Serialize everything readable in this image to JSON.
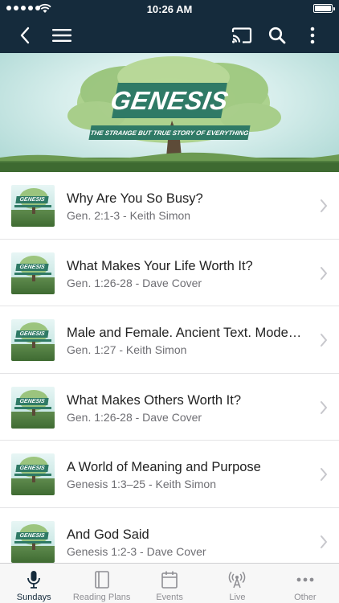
{
  "status_bar": {
    "time": "10:26 AM"
  },
  "nav": {
    "back_icon": "chevron-left-icon",
    "menu_icon": "hamburger-icon",
    "cast_icon": "cast-icon",
    "search_icon": "search-icon",
    "more_icon": "vertical-dots-icon"
  },
  "hero": {
    "title": "GENESIS",
    "subtitle": "THE STRANGE BUT TRUE STORY OF EVERYTHING"
  },
  "sermons": [
    {
      "title": "Why Are You So Busy?",
      "subtitle": "Gen. 2:1-3 - Keith Simon"
    },
    {
      "title": "What Makes Your Life Worth It?",
      "subtitle": "Gen. 1:26-28 - Dave Cover"
    },
    {
      "title": "Male and Female. Ancient Text. Mode…",
      "subtitle": "Gen. 1:27 - Keith Simon"
    },
    {
      "title": "What Makes Others Worth It?",
      "subtitle": "Gen. 1:26-28 - Dave Cover"
    },
    {
      "title": "A World of Meaning and Purpose",
      "subtitle": "Genesis 1:3–25 - Keith Simon"
    },
    {
      "title": "And God Said",
      "subtitle": "Genesis 1:2-3 - Dave Cover"
    }
  ],
  "tabs": [
    {
      "label": "Sundays",
      "icon": "microphone-icon",
      "active": true
    },
    {
      "label": "Reading Plans",
      "icon": "book-icon",
      "active": false
    },
    {
      "label": "Events",
      "icon": "calendar-icon",
      "active": false
    },
    {
      "label": "Live",
      "icon": "broadcast-icon",
      "active": false
    },
    {
      "label": "Other",
      "icon": "more-dots-icon",
      "active": false
    }
  ],
  "colors": {
    "nav_background": "#152b3c",
    "banner_green": "#2f7a66",
    "active_tab": "#152b3c",
    "inactive_tab": "#8e8e93"
  }
}
